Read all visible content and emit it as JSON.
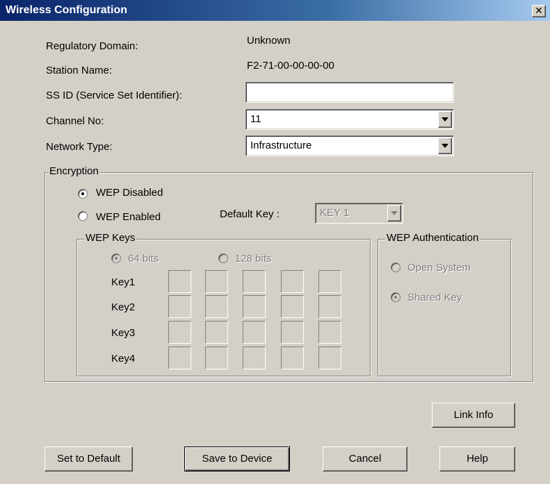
{
  "window": {
    "title": "Wireless Configuration",
    "close_glyph": "✕"
  },
  "info": {
    "regulatory_domain_label": "Regulatory Domain:",
    "regulatory_domain_value": "Unknown",
    "station_name_label": "Station Name:",
    "station_name_value": "F2-71-00-00-00-00"
  },
  "fields": {
    "ssid_label": "SS ID (Service Set Identifier):",
    "ssid_value": "",
    "channel_label": "Channel No:",
    "channel_value": "11",
    "network_type_label": "Network Type:",
    "network_type_value": "Infrastructure"
  },
  "encryption": {
    "legend": "Encryption",
    "wep_disabled_label": "WEP Disabled",
    "wep_enabled_label": "WEP Enabled",
    "selected": "WEP Disabled",
    "default_key_label": "Default Key :",
    "default_key_value": "KEY 1"
  },
  "wep_keys": {
    "legend": "WEP Keys",
    "bits64_label": "64 bits",
    "bits128_label": "128 bits",
    "selected_bits": "64 bits",
    "key_labels": [
      "Key1",
      "Key2",
      "Key3",
      "Key4"
    ]
  },
  "wep_auth": {
    "legend": "WEP Authentication",
    "open_system_label": "Open System",
    "shared_key_label": "Shared Key",
    "selected": "Shared Key"
  },
  "buttons": {
    "link_info": "Link Info",
    "set_default": "Set to Default",
    "save_device": "Save to Device",
    "cancel": "Cancel",
    "help": "Help"
  },
  "icons": [
    "close-icon",
    "chevron-down-icon",
    "radio-icon"
  ]
}
